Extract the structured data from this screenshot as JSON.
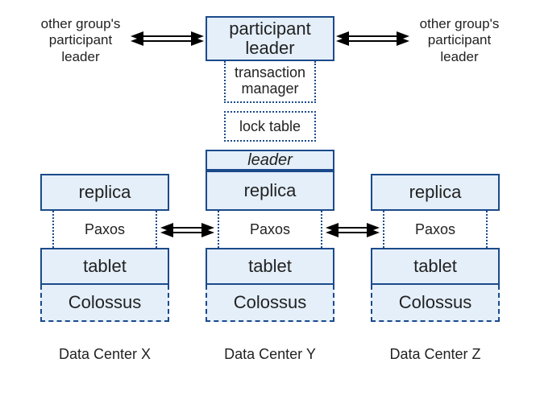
{
  "top": {
    "left_label_line1": "other group's",
    "left_label_line2": "participant",
    "left_label_line3": "leader",
    "right_label_line1": "other group's",
    "right_label_line2": "participant",
    "right_label_line3": "leader",
    "participant_leader_line1": "participant",
    "participant_leader_line2": "leader"
  },
  "mid": {
    "transaction_manager_line1": "transaction",
    "transaction_manager_line2": "manager",
    "lock_table": "lock table",
    "leader": "leader"
  },
  "stacks": {
    "paxos": "Paxos",
    "x": {
      "replica": "replica",
      "tablet": "tablet",
      "colossus": "Colossus",
      "dc": "Data Center X"
    },
    "y": {
      "replica": "replica",
      "tablet": "tablet",
      "colossus": "Colossus",
      "dc": "Data Center Y"
    },
    "z": {
      "replica": "replica",
      "tablet": "tablet",
      "colossus": "Colossus",
      "dc": "Data Center Z"
    }
  }
}
